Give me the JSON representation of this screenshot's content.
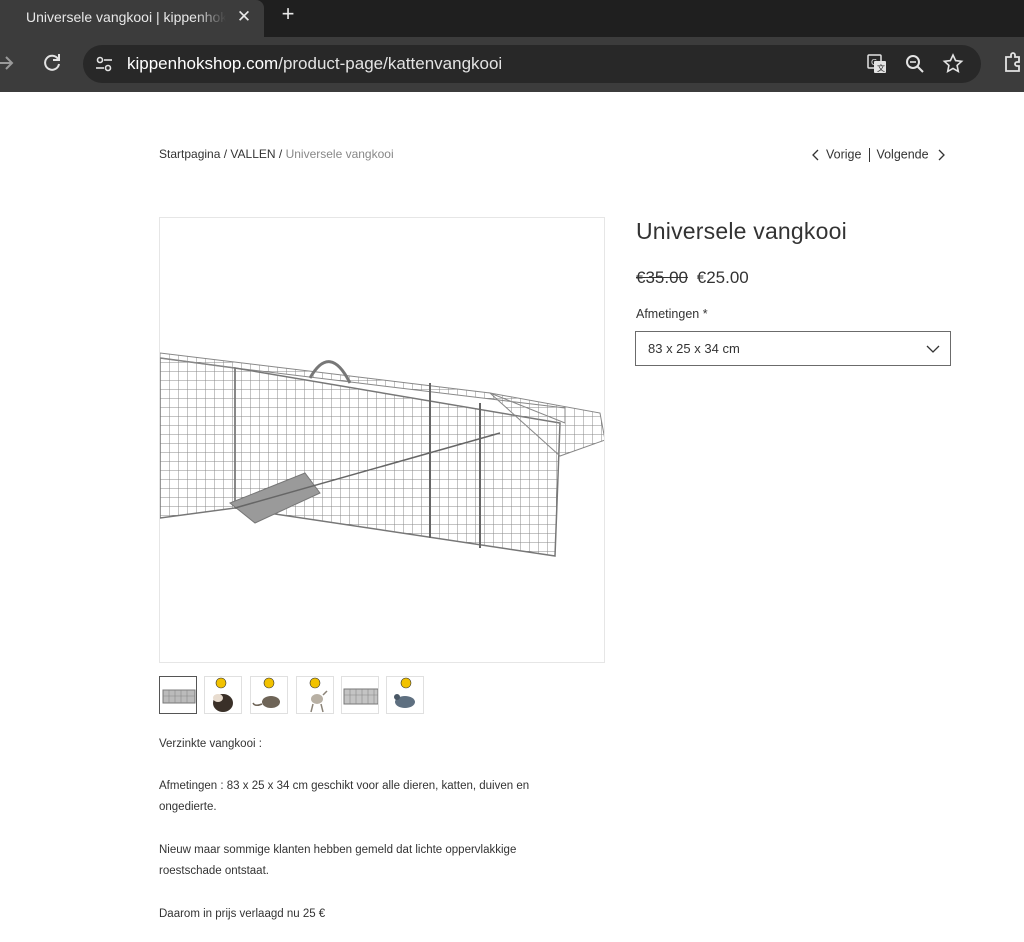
{
  "browser": {
    "tab_title": "Universele vangkooi | kippenhokshop",
    "url_host": "kippenhokshop.com",
    "url_path": "/product-page/kattenvangkooi"
  },
  "breadcrumb": {
    "home": "Startpagina",
    "sep": " / ",
    "category": "VALLEN",
    "current": "Universele vangkooi"
  },
  "pager": {
    "prev": "Vorige",
    "next": "Volgende"
  },
  "product": {
    "title": "Universele vangkooi",
    "old_price": "€35.00",
    "price": "€25.00",
    "option_label": "Afmetingen *",
    "option_value": "83 x 25 x 34 cm"
  },
  "gallery": {
    "thumbnails": [
      "cage",
      "ferret",
      "rat",
      "cat",
      "cage-side",
      "pigeon"
    ]
  },
  "description": {
    "p1": "Verzinkte vangkooi :",
    "p2": "Afmetingen : 83 x 25 x 34 cm  geschikt voor alle dieren, katten, duiven en ongedierte.",
    "p3": "Nieuw maar sommige klanten hebben gemeld dat lichte oppervlakkige roestschade ontstaat.",
    "p4": "Daarom in prijs verlaagd nu 25 €"
  },
  "colors": {
    "chrome_dark": "#1f1f1f",
    "chrome_toolbar": "#3c3c3c",
    "text": "#333333",
    "border": "#6b6b6b"
  }
}
